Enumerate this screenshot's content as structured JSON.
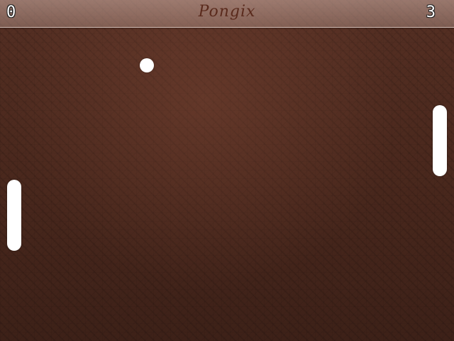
{
  "header": {
    "title": "Pongix",
    "score_left": "0",
    "score_right": "3"
  },
  "colors": {
    "background": "#4a2a1f",
    "paddle": "#ffffff",
    "ball": "#ffffff",
    "title": "#5a2a1c"
  }
}
